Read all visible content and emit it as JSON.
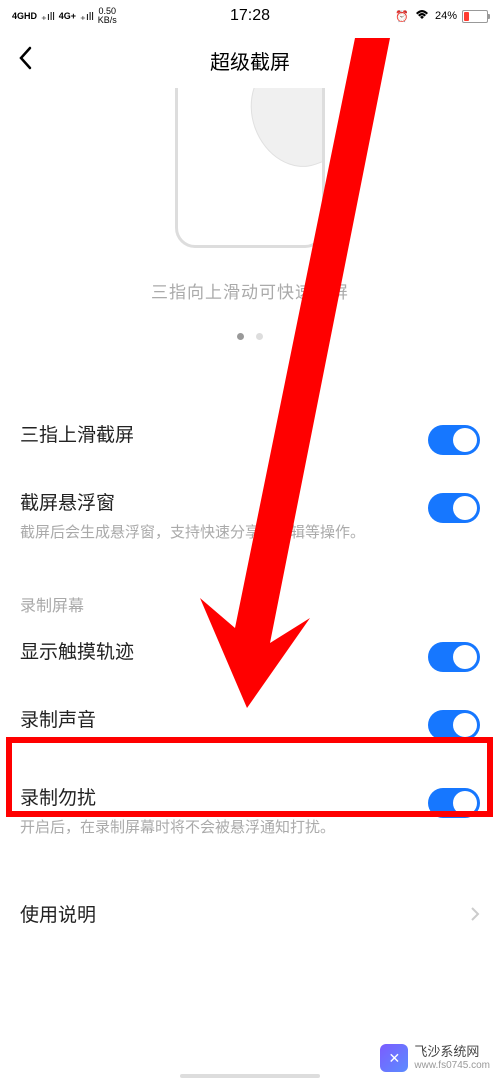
{
  "status": {
    "signal1": "4GHD",
    "signal2": "4G+",
    "speed_value": "0.50",
    "speed_unit": "KB/s",
    "time": "17:28",
    "alarm": "⏰",
    "wifi": "📶",
    "battery_pct": "24%"
  },
  "header": {
    "title": "超级截屏"
  },
  "illustration": {
    "caption": "三指向上滑动可快速截屏"
  },
  "settings": {
    "row1": {
      "title": "三指上滑截屏"
    },
    "row2": {
      "title": "截屏悬浮窗",
      "desc": "截屏后会生成悬浮窗，支持快速分享、编辑等操作。"
    },
    "section_label": "录制屏幕",
    "row3": {
      "title": "显示触摸轨迹"
    },
    "row4": {
      "title": "录制声音"
    },
    "row5": {
      "title": "录制勿扰",
      "desc": "开启后，在录制屏幕时将不会被悬浮通知打扰。"
    },
    "row6": {
      "title": "使用说明"
    }
  },
  "watermark": {
    "title": "飞沙系统网",
    "url": "www.fs0745.com"
  }
}
